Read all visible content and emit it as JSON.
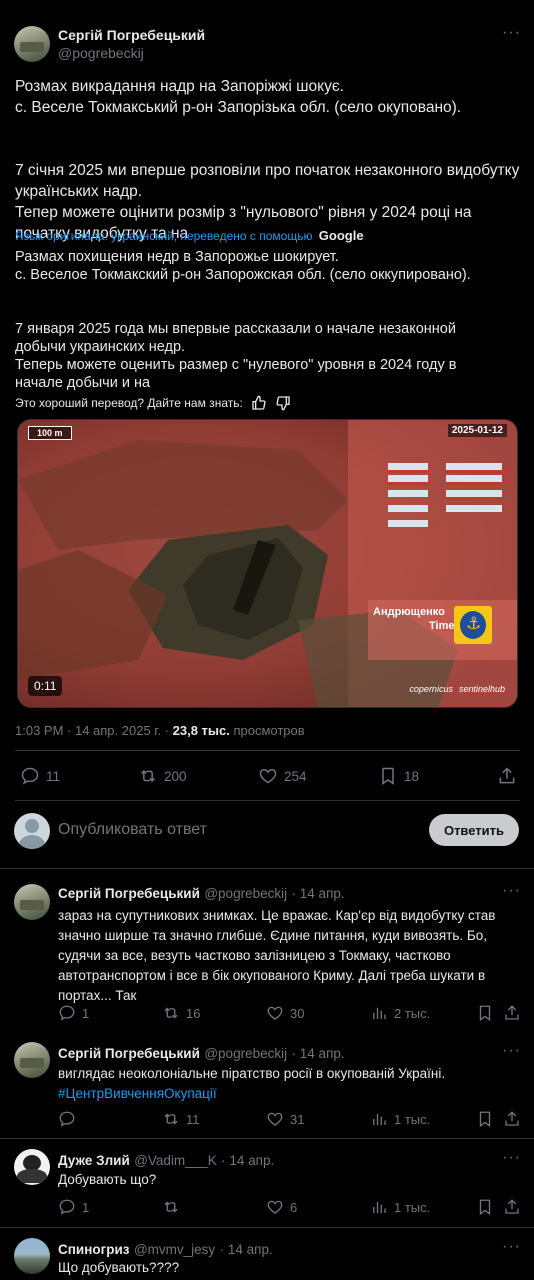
{
  "post": {
    "author_name": "Сергій Погребецький",
    "author_handle": "@pogrebeckij",
    "text_lines": [
      "Розмах викрадання надр на Запоріжжі шокує.",
      "с. Веселе Токмакський р-он Запорізька обл. (село окуповано).",
      "",
      "7 січня 2025 ми вперше розповіли про початок незаконного видобутку",
      "українських надр.",
      "Тепер можете оцінити розмір з \"нульового\" рівня у 2024 році на",
      "початку видобутку та на"
    ],
    "translation_note": "Язык оригинала: украинский, переведено с помощью",
    "translation_brand": "Google",
    "translated_lines": [
      "Размах похищения недр в Запорожье шокирует.",
      "с. Веселое Токмакский р-он Запорожская обл. (село оккупировано).",
      "",
      "7 января 2025 года мы впервые рассказали о начале незаконной",
      "добычи украинских недр.",
      "Теперь можете оценить размер с \"нулевого\" уровня в 2024 году в",
      "начале добычи и на"
    ],
    "feedback_question": "Это хороший перевод? Дайте нам знать:",
    "video": {
      "scale_label": "100 m",
      "date_label": "2025-01-12",
      "channel_label_1": "Андрющенко",
      "channel_label_2": "Time",
      "duration": "0:11",
      "credit_1": "copernicus",
      "credit_2": "sentinelhub"
    },
    "time": "1:03 PM · 14 апр. 2025 г. · ",
    "views_count": "23,8 тыс.",
    "views_label": " просмотров",
    "replies": "11",
    "reposts": "200",
    "likes": "254",
    "bookmarks": "18"
  },
  "compose": {
    "placeholder": "Опубликовать ответ",
    "button": "Ответить"
  },
  "replies": [
    {
      "name": "Сергій Погребецький",
      "handle": "@pogrebeckij",
      "date": "· 14 апр.",
      "lines": [
        "зараз на супутникових знимках.  Це вражає. Кар'єр від видобутку став",
        "значно ширше та значно глибше. Єдине питання, куди вивозять. Бо,",
        "судячи за все, везуть частково залізницею з Токмаку, частково",
        "автотранспортом і все в бік окупованого Криму. Далі треба шукати в",
        "портах...   Так"
      ],
      "replies": "1",
      "reposts": "16",
      "likes": "30",
      "views": "2 тыс."
    },
    {
      "name": "Сергій Погребецький",
      "handle": "@pogrebeckij",
      "date": "· 14 апр.",
      "lines": [
        "виглядає неоколоніальне піратство росії в окупованій Україні."
      ],
      "hashtag": "#ЦентрВивченняОкупації",
      "replies": "",
      "reposts": "11",
      "likes": "31",
      "views": "1 тыс."
    },
    {
      "name": "Дуже Злий",
      "handle": "@Vadim___K",
      "date": "· 14 апр.",
      "lines": [
        "Добувають що?"
      ],
      "replies": "1",
      "reposts": "",
      "likes": "6",
      "views": "1 тыс."
    },
    {
      "name": "Спиногриз",
      "handle": "@mvmv_jesy",
      "date": "· 14 апр.",
      "lines": [
        "Що добувають????"
      ]
    }
  ],
  "colors": {
    "accent": "#1d9bf0",
    "background": "#000000",
    "divider": "#2f3336",
    "muted": "#71767b"
  }
}
